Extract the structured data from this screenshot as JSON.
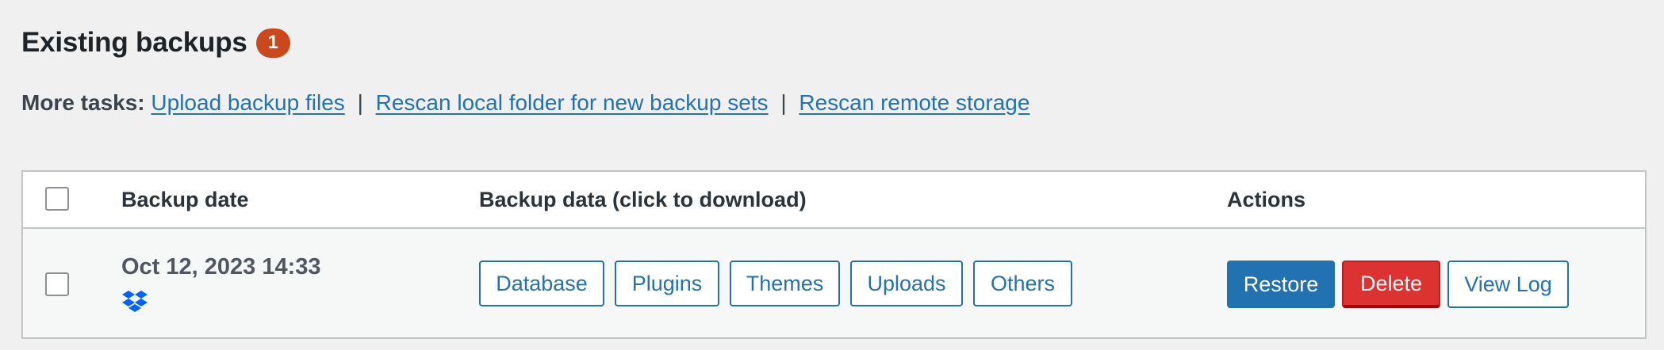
{
  "header": {
    "title": "Existing backups",
    "count_badge": "1"
  },
  "more_tasks": {
    "label": "More tasks:",
    "separator": "|",
    "links": [
      {
        "label": "Upload backup files"
      },
      {
        "label": "Rescan local folder for new backup sets"
      },
      {
        "label": "Rescan remote storage"
      }
    ]
  },
  "table": {
    "columns": {
      "date": "Backup date",
      "data": "Backup data (click to download)",
      "actions": "Actions"
    },
    "rows": [
      {
        "date": "Oct 12, 2023 14:33",
        "storage_icon": "dropbox-icon",
        "data_buttons": [
          "Database",
          "Plugins",
          "Themes",
          "Uploads",
          "Others"
        ],
        "action_buttons": [
          "Restore",
          "Delete",
          "View Log"
        ]
      }
    ]
  },
  "colors": {
    "accent": "#2271b1",
    "badge": "#c9481c",
    "delete": "#dc3232",
    "dropbox": "#0061fe"
  }
}
